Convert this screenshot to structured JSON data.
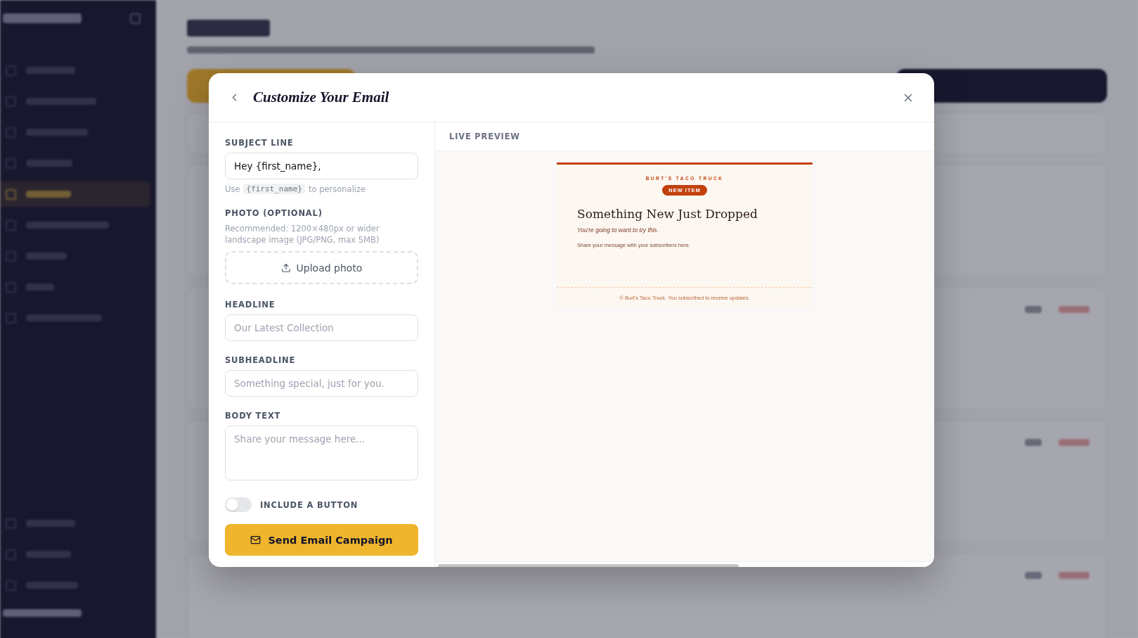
{
  "sidebar": {
    "items": [
      {
        "selected": false
      },
      {
        "selected": false
      },
      {
        "selected": false
      },
      {
        "selected": false
      },
      {
        "selected": true
      },
      {
        "selected": false
      },
      {
        "selected": false
      },
      {
        "selected": false
      },
      {
        "selected": false
      }
    ]
  },
  "modal": {
    "title": "Customize Your Email",
    "subject": {
      "label": "SUBJECT LINE",
      "value": "Hey {first_name},",
      "hint_before": "Use",
      "hint_code": "{first_name}",
      "hint_after": "to personalize"
    },
    "photo": {
      "label": "PHOTO (OPTIONAL)",
      "note": "Recommended: 1200×480px or wider landscape image (JPG/PNG, max 5MB)",
      "button": "Upload photo"
    },
    "fields": [
      {
        "kind": "input",
        "label": "HEADLINE",
        "placeholder": "Our Latest Collection"
      },
      {
        "kind": "input",
        "label": "SUBHEADLINE",
        "placeholder": "Something special, just for you."
      },
      {
        "kind": "textarea",
        "label": "BODY TEXT",
        "placeholder": "Share your message here..."
      }
    ],
    "toggle": {
      "label": "INCLUDE A BUTTON",
      "on": false
    },
    "send_button": "Send Email Campaign",
    "preview": {
      "label": "LIVE PREVIEW",
      "brand": "BURT'S TACO TRUCK",
      "badge": "NEW ITEM",
      "headline": "Something New Just Dropped",
      "subheadline": "You're going to want to try this.",
      "body": "Share your message with your subscribers here.",
      "footer": "© Burt's Taco Truck. You subscribed to receive updates."
    }
  }
}
